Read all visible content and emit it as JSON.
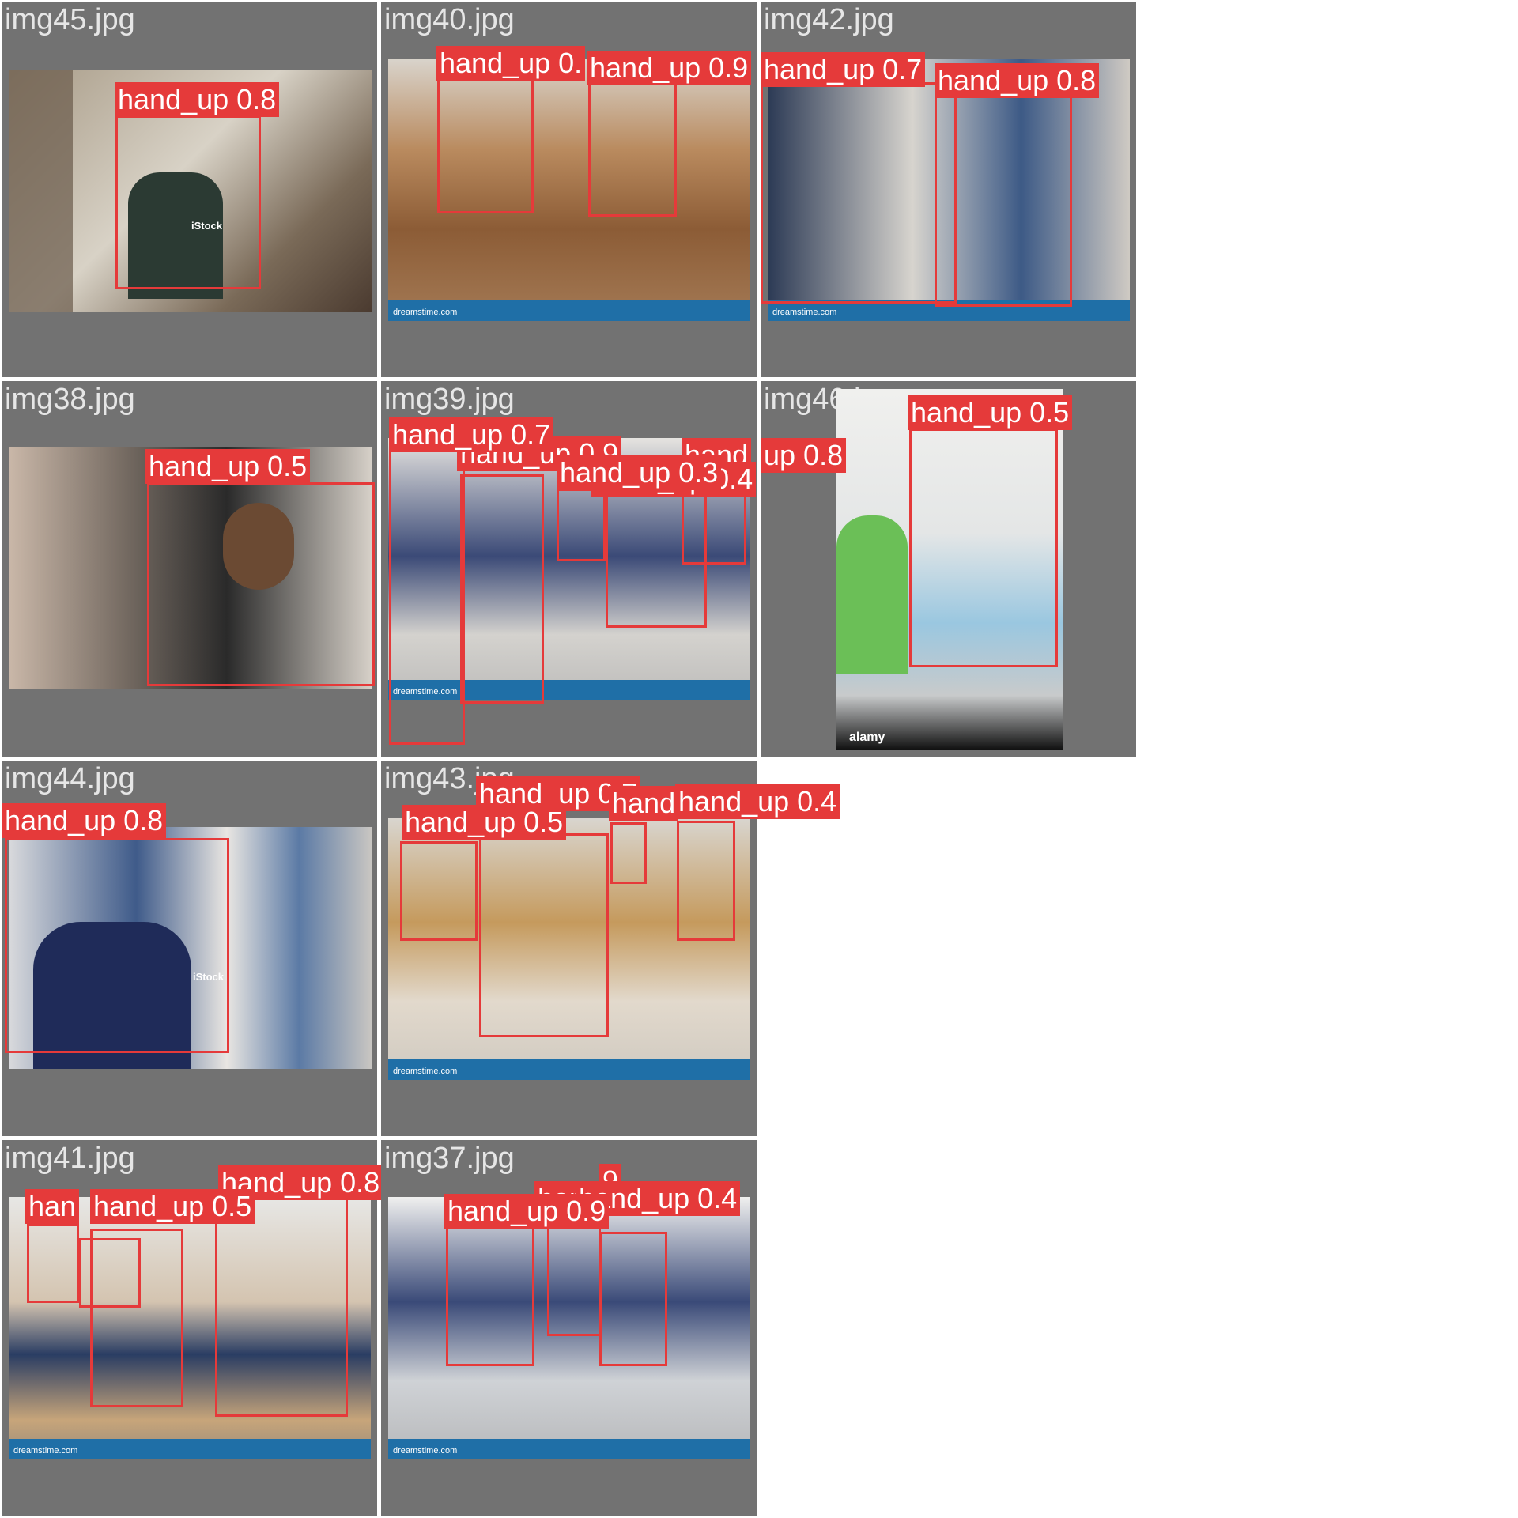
{
  "accent_colors": {
    "tile_bg": "#727272",
    "box": "#e53a3a",
    "label_text": "#ffffff"
  },
  "tiles": [
    {
      "filename": "img45.jpg",
      "detections": [
        {
          "label": "hand_up 0.8"
        }
      ]
    },
    {
      "filename": "img40.jpg",
      "detections": [
        {
          "label": "hand_up 0."
        },
        {
          "label": "hand_up 0.9"
        }
      ]
    },
    {
      "filename": "img42.jpg",
      "detections": [
        {
          "label": "hand_up 0.7"
        },
        {
          "label": "hand_up 0.8"
        }
      ]
    },
    {
      "filename": "img38.jpg",
      "detections": [
        {
          "label": "hand_up 0.5"
        }
      ]
    },
    {
      "filename": "img39.jpg",
      "detections": [
        {
          "label": "hand_up 0.7"
        },
        {
          "label": "hand_up 0.9"
        },
        {
          "label": "hand_up 0.3"
        },
        {
          "label": "hand_up 0.4"
        },
        {
          "label": "hand"
        }
      ]
    },
    {
      "filename": "img46.jpg",
      "detections": [
        {
          "label": "hand_up 0.5"
        },
        {
          "label": "up 0.8"
        }
      ]
    },
    {
      "filename": "img44.jpg",
      "detections": [
        {
          "label": "hand_up 0.8"
        }
      ]
    },
    {
      "filename": "img43.jpg",
      "detections": [
        {
          "label": "hand_up 0.5"
        },
        {
          "label": "hand_up 0.7"
        },
        {
          "label": "hand"
        },
        {
          "label": "hand_up 0.4"
        }
      ]
    },
    {
      "filename": "img41.jpg",
      "detections": [
        {
          "label": "han"
        },
        {
          "label": "hand_up 0.5"
        },
        {
          "label": "hand_up 0.8"
        }
      ]
    },
    {
      "filename": "img37.jpg",
      "detections": [
        {
          "label": "hand_up 0.9"
        },
        {
          "label": "har"
        },
        {
          "label": "hand_up 0.4"
        },
        {
          "label": "9"
        }
      ]
    }
  ],
  "watermarks": {
    "dreamstime": "dreamstime.com",
    "istock": "iStock",
    "alamy": "alamy"
  }
}
